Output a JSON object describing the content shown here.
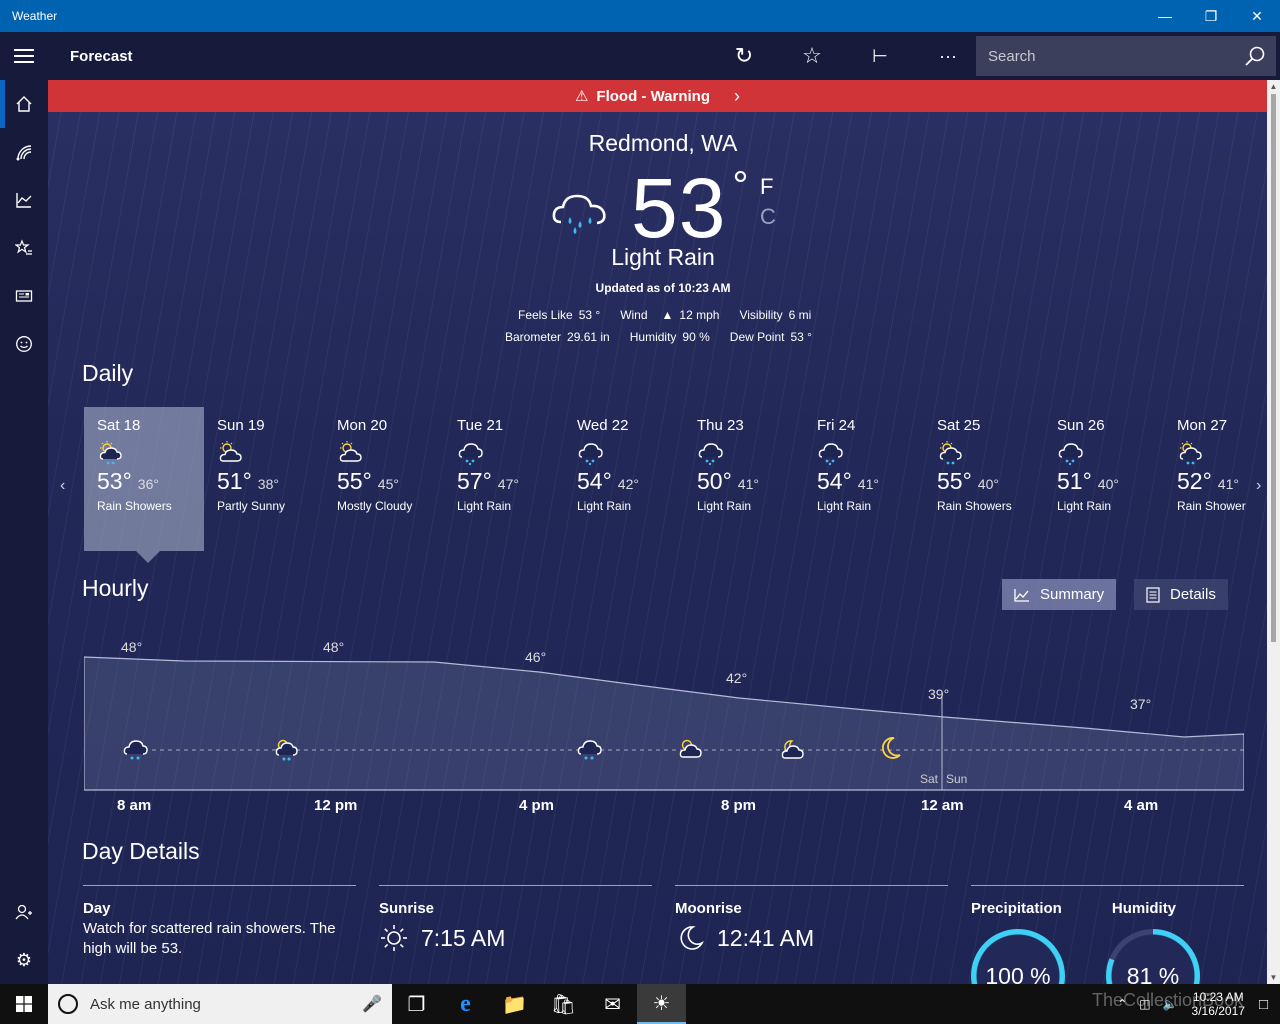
{
  "window": {
    "title": "Weather"
  },
  "header": {
    "title": "Forecast",
    "search_placeholder": "Search"
  },
  "alert": {
    "text": "Flood - Warning"
  },
  "current": {
    "location": "Redmond, WA",
    "temp": "53",
    "degree": "°",
    "unit_f": "F",
    "unit_c": "C",
    "condition": "Light Rain",
    "updated": "Updated as of 10:23 AM",
    "feels_like_label": "Feels Like",
    "feels_like": "53 °",
    "wind_label": "Wind",
    "wind": "12 mph",
    "visibility_label": "Visibility",
    "visibility": "6 mi",
    "barometer_label": "Barometer",
    "barometer": "29.61 in",
    "humidity_label": "Humidity",
    "humidity": "90 %",
    "dewpoint_label": "Dew Point",
    "dewpoint": "53 °"
  },
  "daily": {
    "title": "Daily",
    "days": [
      {
        "name": "Sat 18",
        "hi": "53°",
        "lo": "36°",
        "cond": "Rain Showers",
        "icon": "sun-rain-icon"
      },
      {
        "name": "Sun 19",
        "hi": "51°",
        "lo": "38°",
        "cond": "Partly Sunny",
        "icon": "partly-sunny-icon"
      },
      {
        "name": "Mon 20",
        "hi": "55°",
        "lo": "45°",
        "cond": "Mostly Cloudy",
        "icon": "partly-sunny-icon"
      },
      {
        "name": "Tue 21",
        "hi": "57°",
        "lo": "47°",
        "cond": "Light Rain",
        "icon": "rain-cloud-icon"
      },
      {
        "name": "Wed 22",
        "hi": "54°",
        "lo": "42°",
        "cond": "Light Rain",
        "icon": "rain-cloud-icon"
      },
      {
        "name": "Thu 23",
        "hi": "50°",
        "lo": "41°",
        "cond": "Light Rain",
        "icon": "rain-cloud-icon"
      },
      {
        "name": "Fri 24",
        "hi": "54°",
        "lo": "41°",
        "cond": "Light Rain",
        "icon": "rain-cloud-icon"
      },
      {
        "name": "Sat 25",
        "hi": "55°",
        "lo": "40°",
        "cond": "Rain Showers",
        "icon": "sun-rain-icon"
      },
      {
        "name": "Sun 26",
        "hi": "51°",
        "lo": "40°",
        "cond": "Light Rain",
        "icon": "rain-cloud-icon"
      },
      {
        "name": "Mon 27",
        "hi": "52°",
        "lo": "41°",
        "cond": "Rain Shower",
        "icon": "sun-rain-icon"
      }
    ]
  },
  "hourly": {
    "title": "Hourly",
    "summary_label": "Summary",
    "details_label": "Details",
    "temps": [
      {
        "label": "48°"
      },
      {
        "label": "48°"
      },
      {
        "label": "46°"
      },
      {
        "label": "42°"
      },
      {
        "label": "39°"
      },
      {
        "label": "37°"
      }
    ],
    "times": [
      "8 am",
      "12 pm",
      "4 pm",
      "8 pm",
      "12 am",
      "4 am"
    ],
    "day_split": [
      "Sat",
      "Sun"
    ]
  },
  "details": {
    "title": "Day Details",
    "day_label": "Day",
    "day_text": "Watch for scattered rain showers. The high will be 53.",
    "sunrise_label": "Sunrise",
    "sunrise": "7:15 AM",
    "moonrise_label": "Moonrise",
    "moonrise": "12:41 AM",
    "precip_label": "Precipitation",
    "precip": "100 %",
    "precip_value": 1.0,
    "humidity_label": "Humidity",
    "humidity": "81 %",
    "humidity_value": 0.81
  },
  "taskbar": {
    "search_placeholder": "Ask me anything",
    "time": "10:23 AM",
    "date": "3/16/2017",
    "watermark": "TheCollectionBook"
  },
  "colors": {
    "title_bar": "#0063b1",
    "alert": "#d13438",
    "sidebar": "#161b3c",
    "ring": "#3fd1f5"
  }
}
